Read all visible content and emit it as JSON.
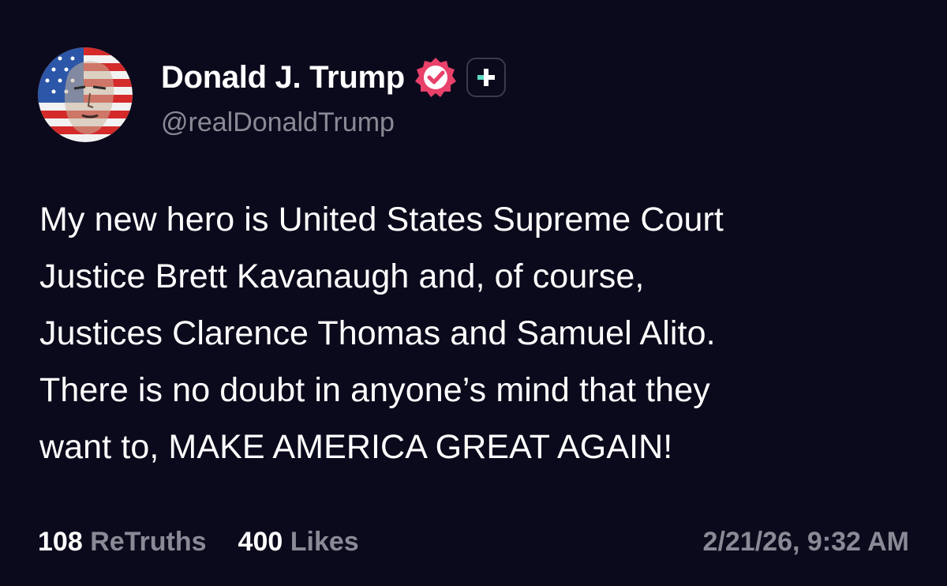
{
  "post": {
    "author": {
      "display_name": "Donald J. Trump",
      "handle": "@realDonaldTrump",
      "avatar_icon": "avatar-flag-portrait",
      "verified_icon": "verified-badge-icon",
      "verified_color": "#e8416a",
      "plus_icon": "plus-badge-icon",
      "plus_color": "#5fd9c4"
    },
    "body_lines": [
      "My new hero is United States Supreme Court",
      "Justice Brett Kavanaugh and, of course,",
      "Justices Clarence Thomas and Samuel Alito.",
      "There is no doubt in anyone’s mind that they",
      "want to, MAKE AMERICA GREAT AGAIN!"
    ],
    "stats": {
      "retruths_count": "108",
      "retruths_label": "ReTruths",
      "likes_count": "400",
      "likes_label": "Likes"
    },
    "timestamp": "2/21/26, 9:32 AM"
  },
  "colors": {
    "background": "#0b0a1c",
    "text_primary": "#ffffff",
    "text_secondary": "#8a8a96"
  }
}
